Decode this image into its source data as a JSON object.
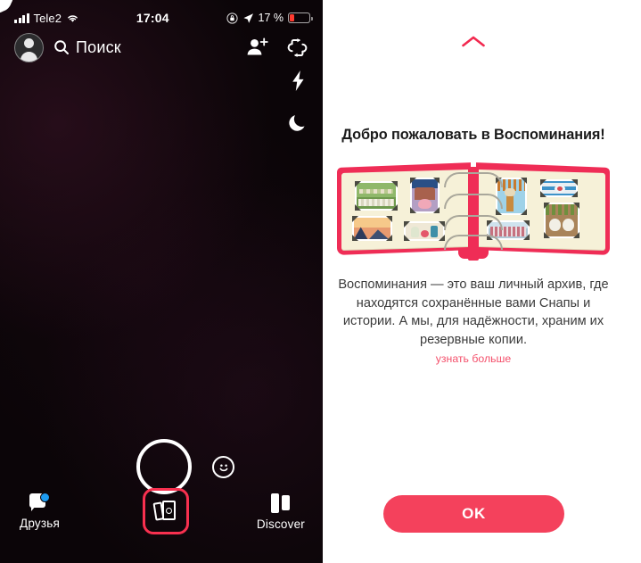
{
  "left_panel": {
    "status_bar": {
      "signal_icon": "cellular-signal-icon",
      "carrier": "Tele2",
      "wifi_icon": "wifi-icon",
      "time": "17:04",
      "rotation_lock_icon": "rotation-lock-icon",
      "location_icon": "location-arrow-icon",
      "battery_percent": "17 %",
      "battery_icon": "battery-low-icon"
    },
    "top_bar": {
      "avatar_name": "profile-avatar",
      "search_icon": "search-icon",
      "search_label": "Поиск",
      "add_friend_icon": "add-friend-icon",
      "flip_camera_icon": "flip-camera-icon"
    },
    "camera_controls": {
      "flash_icon": "flash-icon",
      "night_mode_icon": "moon-night-mode-icon",
      "shutter_name": "shutter-button",
      "lenses_icon": "smiley-lenses-icon"
    },
    "bottom_nav": {
      "friends_label": "Друзья",
      "friends_icon": "chat-bubble-icon",
      "friends_badge": "unread-badge-dot",
      "memories_icon": "memories-cards-icon",
      "memories_highlight_color": "#f8304f",
      "discover_label": "Discover",
      "discover_icon": "discover-cards-icon"
    }
  },
  "right_panel": {
    "collapse_chevron_icon": "chevron-up-icon",
    "title": "Добро пожаловать в Воспоминания!",
    "illustration": {
      "name": "photo-album-illustration",
      "cover_color": "#ef2d56",
      "page_color": "#f6f1d8",
      "photo_count": 8
    },
    "body_text": "Воспоминания — это ваш личный архив, где находятся сохранённые вами Снапы и истории. А мы, для надёжности, храним их резервные копии.",
    "learn_more_label": "узнать больше",
    "ok_button_label": "OK",
    "accent_color": "#f4415c"
  }
}
